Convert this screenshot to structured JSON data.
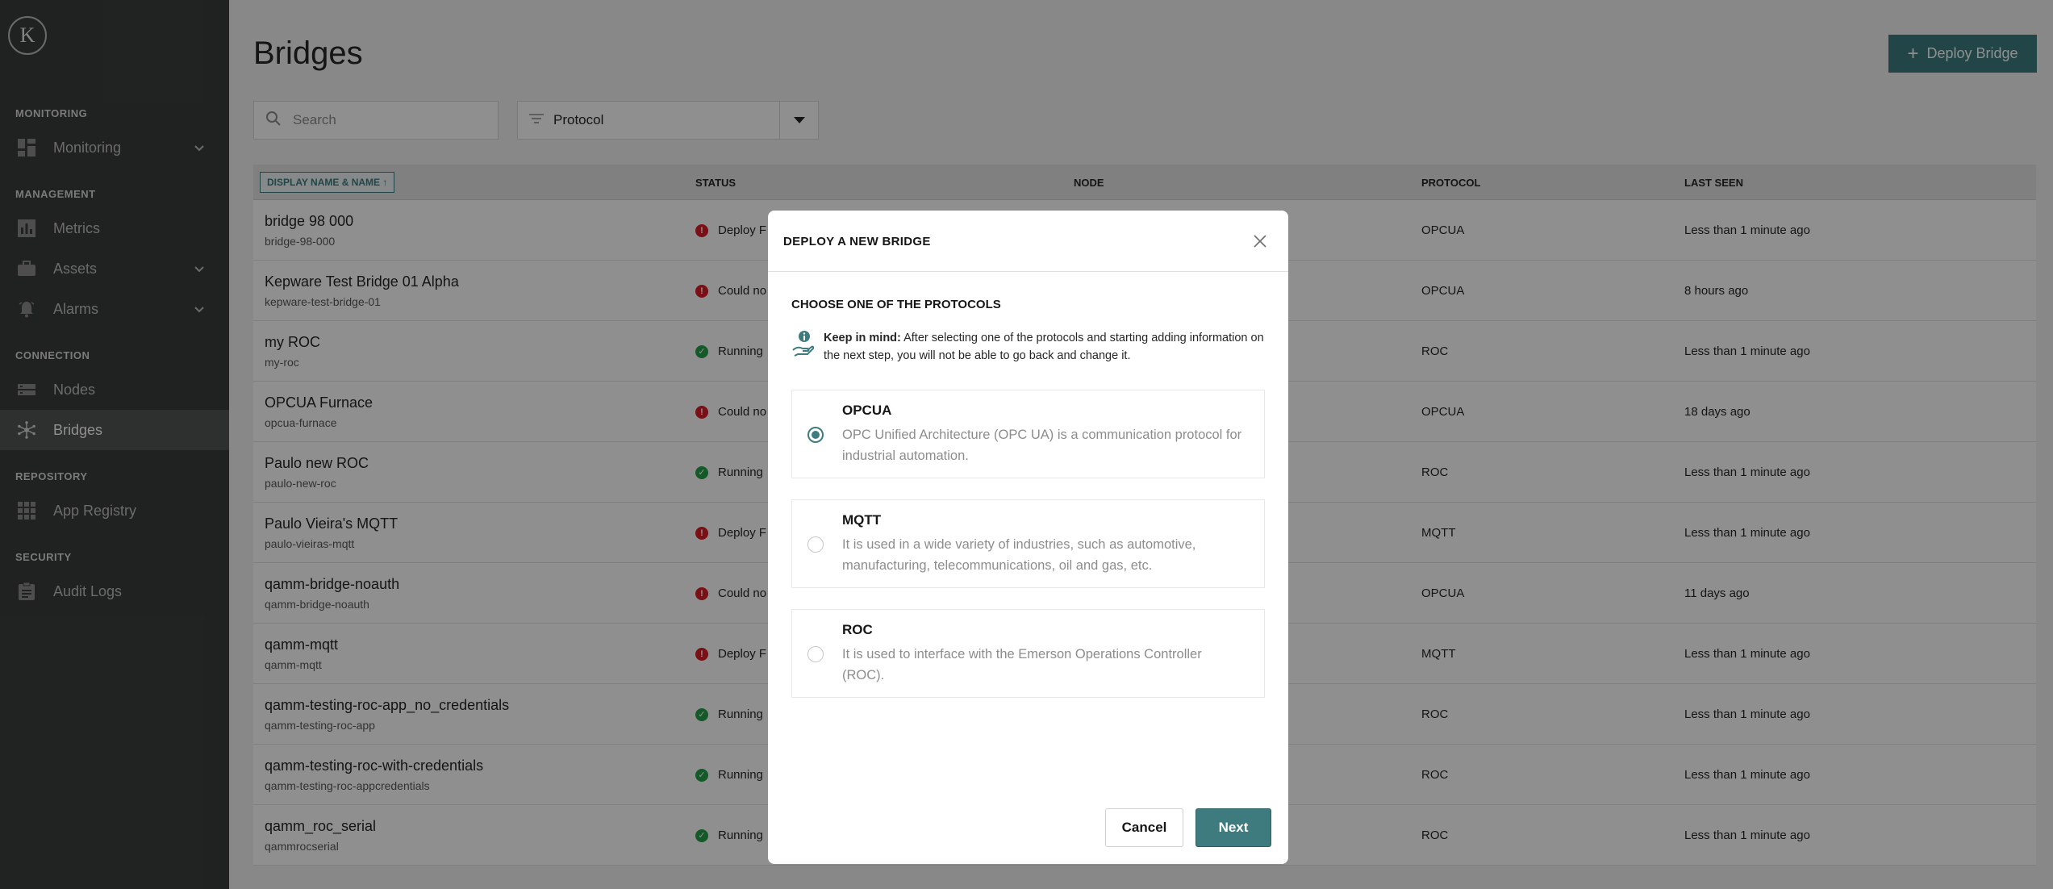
{
  "logo": {
    "letter": "K"
  },
  "sidebar": {
    "sections": [
      {
        "title": "MONITORING"
      },
      {
        "title": "MANAGEMENT"
      },
      {
        "title": "CONNECTION"
      },
      {
        "title": "REPOSITORY"
      },
      {
        "title": "SECURITY"
      }
    ],
    "items": [
      {
        "label": "Monitoring",
        "icon": "dashboard-icon",
        "expandable": true
      },
      {
        "label": "Metrics",
        "icon": "bar-chart-icon",
        "expandable": false
      },
      {
        "label": "Assets",
        "icon": "briefcase-icon",
        "expandable": true
      },
      {
        "label": "Alarms",
        "icon": "bell-icon",
        "expandable": true
      },
      {
        "label": "Nodes",
        "icon": "server-icon",
        "expandable": false
      },
      {
        "label": "Bridges",
        "icon": "network-icon",
        "expandable": false,
        "active": true
      },
      {
        "label": "App Registry",
        "icon": "grid-icon",
        "expandable": false
      },
      {
        "label": "Audit Logs",
        "icon": "clipboard-icon",
        "expandable": false
      }
    ]
  },
  "header": {
    "title": "Bridges",
    "deploy_label": "Deploy Bridge"
  },
  "filters": {
    "search_placeholder": "Search",
    "protocol_label": "Protocol"
  },
  "table": {
    "columns": [
      "DISPLAY NAME & NAME",
      "STATUS",
      "NODE",
      "PROTOCOL",
      "LAST SEEN"
    ],
    "rows": [
      {
        "display": "bridge 98 000",
        "name": "bridge-98-000",
        "status": "Deploy F",
        "state": "error",
        "protocol": "OPCUA",
        "last_seen": "Less than 1 minute ago"
      },
      {
        "display": "Kepware Test Bridge 01 Alpha",
        "name": "kepware-test-bridge-01",
        "status": "Could no",
        "state": "error",
        "protocol": "OPCUA",
        "last_seen": "8 hours ago"
      },
      {
        "display": "my ROC",
        "name": "my-roc",
        "status": "Running",
        "state": "ok",
        "protocol": "ROC",
        "last_seen": "Less than 1 minute ago"
      },
      {
        "display": "OPCUA Furnace",
        "name": "opcua-furnace",
        "status": "Could no",
        "state": "error",
        "protocol": "OPCUA",
        "last_seen": "18 days ago"
      },
      {
        "display": "Paulo new ROC",
        "name": "paulo-new-roc",
        "status": "Running",
        "state": "ok",
        "protocol": "ROC",
        "last_seen": "Less than 1 minute ago"
      },
      {
        "display": "Paulo Vieira's MQTT",
        "name": "paulo-vieiras-mqtt",
        "status": "Deploy F",
        "state": "error",
        "protocol": "MQTT",
        "last_seen": "Less than 1 minute ago"
      },
      {
        "display": "qamm-bridge-noauth",
        "name": "qamm-bridge-noauth",
        "status": "Could no",
        "state": "error",
        "protocol": "OPCUA",
        "last_seen": "11 days ago"
      },
      {
        "display": "qamm-mqtt",
        "name": "qamm-mqtt",
        "status": "Deploy F",
        "state": "error",
        "protocol": "MQTT",
        "last_seen": "Less than 1 minute ago"
      },
      {
        "display": "qamm-testing-roc-app_no_credentials",
        "name": "qamm-testing-roc-app",
        "status": "Running",
        "state": "ok",
        "protocol": "ROC",
        "last_seen": "Less than 1 minute ago"
      },
      {
        "display": "qamm-testing-roc-with-credentials",
        "name": "qamm-testing-roc-appcredentials",
        "status": "Running",
        "state": "ok",
        "protocol": "ROC",
        "last_seen": "Less than 1 minute ago"
      },
      {
        "display": "qamm_roc_serial",
        "name": "qammrocserial",
        "status": "Running",
        "state": "ok",
        "protocol": "ROC",
        "last_seen": "Less than 1 minute ago"
      }
    ]
  },
  "modal": {
    "title": "DEPLOY A NEW BRIDGE",
    "subtitle": "CHOOSE ONE OF THE PROTOCOLS",
    "keep_in_mind_label": "Keep in mind:",
    "keep_in_mind_text": " After selecting one of the protocols and starting adding information on the next step, you will not be able to go back and change it.",
    "options": [
      {
        "title": "OPCUA",
        "desc": "OPC Unified Architecture (OPC UA) is a communication protocol for industrial automation.",
        "selected": true
      },
      {
        "title": "MQTT",
        "desc": "It is used in a wide variety of industries, such as automotive, manufacturing, telecommunications, oil and gas, etc.",
        "selected": false
      },
      {
        "title": "ROC",
        "desc": "It is used to interface with the Emerson Operations Controller (ROC).",
        "selected": false
      }
    ],
    "cancel_label": "Cancel",
    "next_label": "Next"
  },
  "colors": {
    "accent": "#3e7b7f",
    "sidebar_bg": "#3a3d3c",
    "error": "#da1e28",
    "success": "#24a148"
  }
}
